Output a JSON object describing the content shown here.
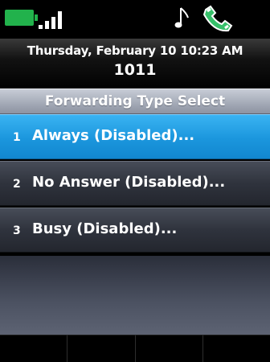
{
  "status": {
    "battery_icon": "battery-icon",
    "signal_icon": "signal-bars-icon",
    "note_icon": "music-note-icon",
    "handset_icon": "handset-icon",
    "battery_color": "#22b24c",
    "handset_color": "#36c06a"
  },
  "header": {
    "date_time": "Thursday, February 10 10:23 AM",
    "extension": "1011"
  },
  "title": "Forwarding Type Select",
  "menu": {
    "items": [
      {
        "number": "1",
        "label": "Always (Disabled)...",
        "selected": true
      },
      {
        "number": "2",
        "label": "No Answer (Disabled)...",
        "selected": false
      },
      {
        "number": "3",
        "label": "Busy (Disabled)...",
        "selected": false
      }
    ]
  },
  "softkeys": [
    {
      "label": ""
    },
    {
      "label": ""
    },
    {
      "label": ""
    },
    {
      "label": ""
    }
  ],
  "colors": {
    "selected_item": "#1b96dd",
    "list_item": "#2f333d",
    "title_bar": "#a3a9b6"
  }
}
